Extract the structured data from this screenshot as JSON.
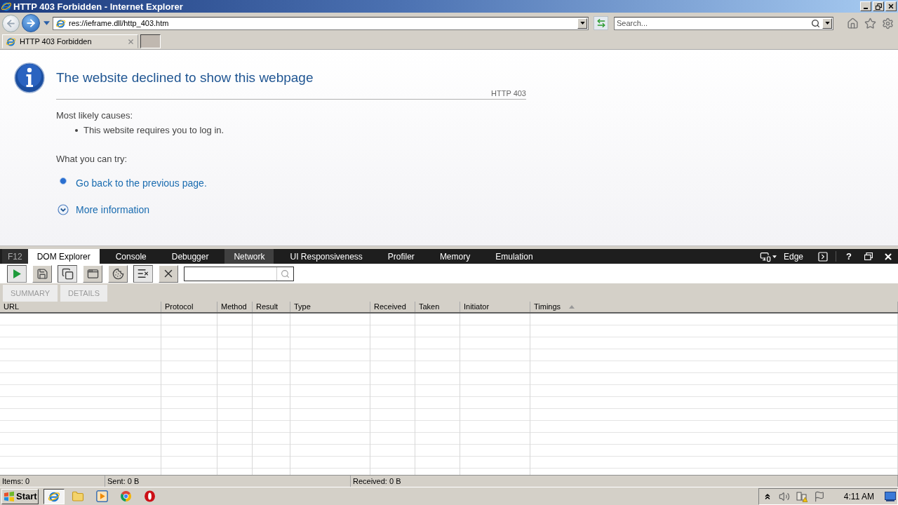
{
  "window": {
    "title": "HTTP 403 Forbidden - Internet Explorer"
  },
  "address_bar": {
    "value": "res://ieframe.dll/http_403.htm"
  },
  "search_box": {
    "placeholder": "Search..."
  },
  "tabs": [
    {
      "label": "HTTP 403 Forbidden",
      "selected": true
    }
  ],
  "page": {
    "heading": "The website declined to show this webpage",
    "error_code": "HTTP 403",
    "causes_title": "Most likely causes:",
    "causes": [
      "This website requires you to log in."
    ],
    "try_title": "What you can try:",
    "actions": [
      {
        "kind": "link",
        "label": "Go back to the previous page."
      },
      {
        "kind": "expander",
        "label": "More information",
        "expanded": false
      }
    ]
  },
  "devtools": {
    "label": "F12",
    "tabs": [
      {
        "label": "DOM Explorer",
        "selected": false,
        "hovered": true
      },
      {
        "label": "Console",
        "selected": false,
        "hovered": false
      },
      {
        "label": "Debugger",
        "selected": false,
        "hovered": false
      },
      {
        "label": "Network",
        "selected": true,
        "hovered": false
      },
      {
        "label": "UI Responsiveness",
        "selected": false,
        "hovered": false
      },
      {
        "label": "Profiler",
        "selected": false,
        "hovered": false
      },
      {
        "label": "Memory",
        "selected": false,
        "hovered": false
      },
      {
        "label": "Emulation",
        "selected": false,
        "hovered": false
      }
    ],
    "emulation": "Edge",
    "help": "?",
    "toolbar": [
      {
        "on": true
      },
      {
        "on": false
      },
      {
        "on": true
      },
      {
        "on": false
      },
      {
        "on": false
      },
      {
        "on": true
      },
      {
        "on": false
      }
    ],
    "subtabs": [
      {
        "label": "SUMMARY",
        "disabled": true
      },
      {
        "label": "DETAILS",
        "disabled": true
      }
    ],
    "columns": [
      {
        "label": "URL",
        "sorted": false
      },
      {
        "label": "Protocol",
        "sorted": false
      },
      {
        "label": "Method",
        "sorted": false
      },
      {
        "label": "Result",
        "sorted": false
      },
      {
        "label": "Type",
        "sorted": false
      },
      {
        "label": "Received",
        "sorted": false
      },
      {
        "label": "Taken",
        "sorted": false
      },
      {
        "label": "Initiator",
        "sorted": false
      },
      {
        "label": "Timings",
        "sorted": true
      }
    ],
    "status": [
      "Items: 0",
      "Sent: 0 B",
      "Received: 0 B"
    ]
  },
  "taskbar": {
    "start": "Start",
    "apps": [
      {
        "selected": true
      },
      {
        "selected": false
      },
      {
        "selected": false
      },
      {
        "selected": false
      },
      {
        "selected": false
      }
    ],
    "clock": "4:11 AM"
  }
}
